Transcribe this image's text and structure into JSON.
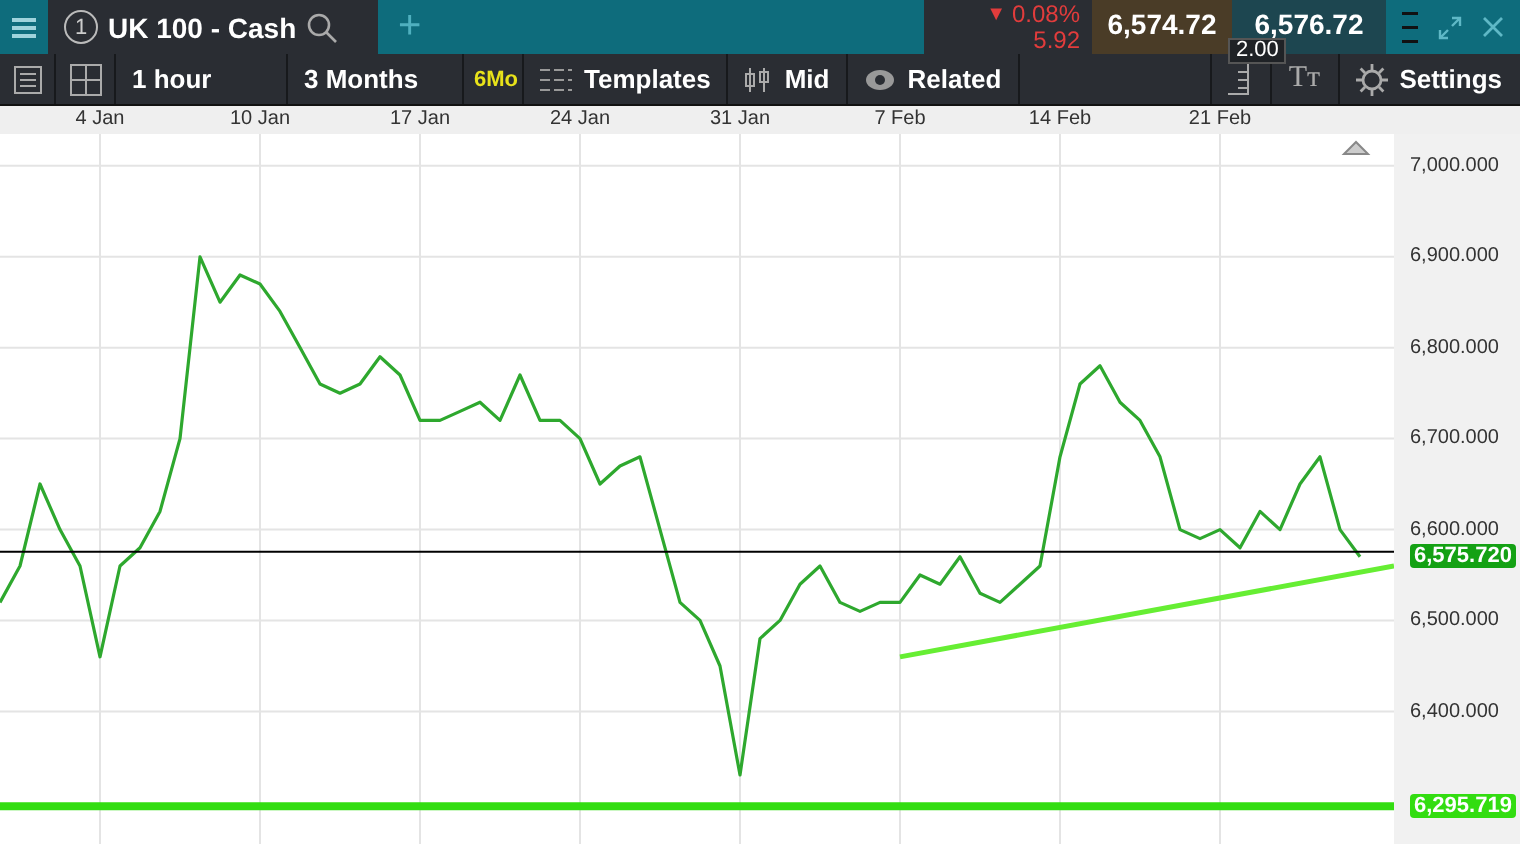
{
  "top_bar": {
    "tab": {
      "number": "1",
      "title": "UK 100 - Cash",
      "selected": true
    },
    "add_tab": "+",
    "change": {
      "arrow": "▼",
      "percent": "0.08%",
      "points": "5.92"
    },
    "bid": "6,574.72",
    "ask": "6,576.72",
    "spread": "2.00"
  },
  "toolbar": {
    "interval": "1 hour",
    "range": "3 Months",
    "range_badge": "6Mo",
    "templates": "Templates",
    "price_type": "Mid",
    "related": "Related",
    "text_size": "Tт",
    "settings": "Settings"
  },
  "chart": {
    "chart_data": {
      "type": "line",
      "grid": true,
      "categories": [
        null,
        null,
        null,
        null,
        null,
        "4 Jan",
        null,
        null,
        null,
        null,
        null,
        null,
        null,
        "10 Jan",
        null,
        null,
        null,
        null,
        null,
        null,
        null,
        "17 Jan",
        null,
        null,
        null,
        null,
        null,
        null,
        null,
        "24 Jan",
        null,
        null,
        null,
        null,
        null,
        null,
        null,
        "31 Jan",
        null,
        null,
        null,
        null,
        null,
        null,
        null,
        "7 Feb",
        null,
        null,
        null,
        null,
        null,
        null,
        null,
        "14 Feb",
        null,
        null,
        null,
        null,
        null,
        null,
        null,
        "21 Feb",
        null,
        null,
        null,
        null,
        null,
        null,
        null
      ],
      "ylim": [
        6252,
        7035
      ],
      "yticks": [
        {
          "value": 7000,
          "label": "7,000.000"
        },
        {
          "value": 6900,
          "label": "6,900.000"
        },
        {
          "value": 6800,
          "label": "6,800.000"
        },
        {
          "value": 6700,
          "label": "6,700.000"
        },
        {
          "value": 6600,
          "label": "6,600.000"
        },
        {
          "value": 6500,
          "label": "6,500.000"
        },
        {
          "value": 6400,
          "label": "6,400.000"
        }
      ],
      "series": [
        {
          "color": "#2ea82e",
          "values": [
            6520,
            6560,
            6650,
            6600,
            6560,
            6460,
            6560,
            6580,
            6620,
            6700,
            6900,
            6850,
            6880,
            6870,
            6840,
            6800,
            6760,
            6750,
            6760,
            6790,
            6770,
            6720,
            6720,
            6730,
            6740,
            6720,
            6770,
            6720,
            6720,
            6700,
            6650,
            6670,
            6680,
            6600,
            6520,
            6500,
            6450,
            6330,
            6480,
            6500,
            6540,
            6560,
            6520,
            6510,
            6520,
            6520,
            6550,
            6540,
            6570,
            6530,
            6520,
            6540,
            6560,
            6680,
            6760,
            6780,
            6740,
            6720,
            6680,
            6600,
            6590,
            6600,
            6580,
            6620,
            6600,
            6650,
            6680,
            6600,
            6570
          ]
        }
      ],
      "ref_lines": [
        {
          "axis": "y",
          "value": 6575.72,
          "label": "6,575.720",
          "color": "#000000"
        },
        {
          "axis": "y",
          "value": 6295.719,
          "label": "6,295.719",
          "color": "#33dd11"
        }
      ]
    }
  }
}
